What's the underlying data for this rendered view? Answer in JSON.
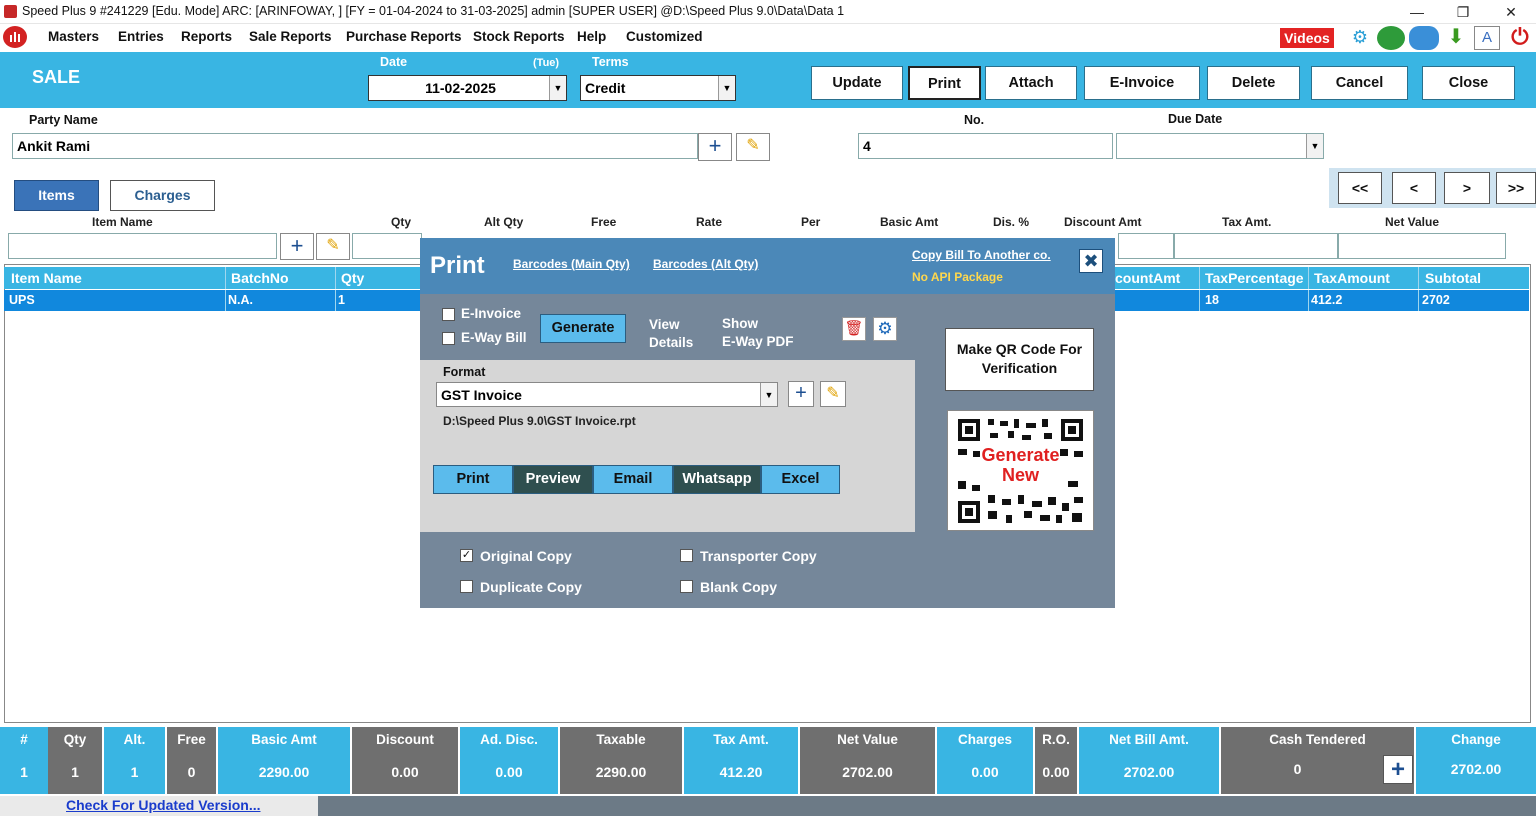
{
  "window": {
    "title": "Speed Plus 9 #241229  [Edu. Mode] ARC:   [ARINFOWAY, ]  [FY = 01-04-2024 to 31-03-2025]  admin  [SUPER USER]  @D:\\Speed Plus 9.0\\Data\\Data 1"
  },
  "menu": {
    "items": [
      "Masters",
      "Entries",
      "Reports",
      "Sale Reports",
      "Purchase Reports",
      "Stock Reports",
      "Help",
      "Customized"
    ],
    "videos": "Videos",
    "letter_a": "A"
  },
  "header": {
    "title": "SALE",
    "date_label": "Date",
    "date_value": "11-02-2025",
    "day": "(Tue)",
    "terms_label": "Terms",
    "terms_value": "Credit",
    "buttons": {
      "update": "Update",
      "print": "Print",
      "attach": "Attach",
      "einvoice": "E-Invoice",
      "delete": "Delete",
      "cancel": "Cancel",
      "close": "Close"
    }
  },
  "party": {
    "label": "Party Name",
    "value": "Ankit Rami",
    "no_label": "No.",
    "no_value": "4",
    "due_label": "Due Date",
    "due_value": ""
  },
  "tabs": {
    "items": "Items",
    "charges": "Charges"
  },
  "nav": {
    "first": "<<",
    "prev": "<",
    "next": ">",
    "last": ">>"
  },
  "entry_columns": {
    "item_name": "Item Name",
    "qty": "Qty",
    "alt_qty": "Alt Qty",
    "free": "Free",
    "rate": "Rate",
    "per": "Per",
    "basic_amt": "Basic Amt",
    "dis_pct": "Dis. %",
    "discount_amt": "Discount Amt",
    "tax_amt": "Tax Amt.",
    "net_value": "Net Value"
  },
  "grid": {
    "headers": {
      "item_name": "Item Name",
      "batch": "BatchNo",
      "qty": "Qty",
      "discount": "countAmt",
      "taxpct": "TaxPercentage",
      "taxamt": "TaxAmount",
      "subtotal": "Subtotal"
    },
    "row": {
      "item_name": "UPS",
      "batch": "N.A.",
      "qty": "1",
      "taxpct": "18",
      "taxamt": "412.2",
      "subtotal": "2702"
    }
  },
  "footer": {
    "hash": {
      "label": "#",
      "value": "1"
    },
    "qty": {
      "label": "Qty",
      "value": "1"
    },
    "alt": {
      "label": "Alt.",
      "value": "1"
    },
    "free": {
      "label": "Free",
      "value": "0"
    },
    "basic": {
      "label": "Basic Amt",
      "value": "2290.00"
    },
    "discount": {
      "label": "Discount",
      "value": "0.00"
    },
    "addisc": {
      "label": "Ad. Disc.",
      "value": "0.00"
    },
    "taxable": {
      "label": "Taxable",
      "value": "2290.00"
    },
    "taxamt": {
      "label": "Tax Amt.",
      "value": "412.20"
    },
    "netvalue": {
      "label": "Net Value",
      "value": "2702.00"
    },
    "charges": {
      "label": "Charges",
      "value": "0.00"
    },
    "ro": {
      "label": "R.O.",
      "value": "0.00"
    },
    "netbill": {
      "label": "Net Bill Amt.",
      "value": "2702.00"
    },
    "cash": {
      "label": "Cash Tendered",
      "value": "0"
    },
    "change": {
      "label": "Change",
      "value": "2702.00"
    }
  },
  "status": {
    "update_link": "Check For Updated Version..."
  },
  "print_dialog": {
    "title": "Print",
    "barcode_main": "Barcodes (Main Qty)",
    "barcode_alt": "Barcodes (Alt Qty)",
    "copy_bill": "Copy Bill To Another co.",
    "api": "No API Package",
    "einvoice": "E-Invoice",
    "ewaybill": "E-Way Bill",
    "generate": "Generate",
    "view_details": [
      "View",
      "Details"
    ],
    "show_pdf": [
      "Show",
      "E-Way PDF"
    ],
    "format_label": "Format",
    "format_value": "GST Invoice",
    "format_path": "D:\\Speed Plus 9.0\\GST Invoice.rpt",
    "actions": {
      "print": "Print",
      "preview": "Preview",
      "email": "Email",
      "whatsapp": "Whatsapp",
      "excel": "Excel"
    },
    "qr_button": [
      "Make QR Code For",
      "Verification"
    ],
    "qr_overlay": [
      "Generate",
      "New"
    ],
    "copies": {
      "original": {
        "label": "Original Copy",
        "checked": true
      },
      "duplicate": {
        "label": "Duplicate Copy",
        "checked": false
      },
      "transporter": {
        "label": "Transporter Copy",
        "checked": false
      },
      "blank": {
        "label": "Blank Copy",
        "checked": false
      }
    }
  },
  "colors": {
    "accent": "#39b5e3",
    "row_selected": "#1188dd",
    "dialog_bg": "#75879a",
    "dialog_head": "#4b88b8",
    "videos_red": "#e32323",
    "footer_grey": "#6f6f6f"
  }
}
